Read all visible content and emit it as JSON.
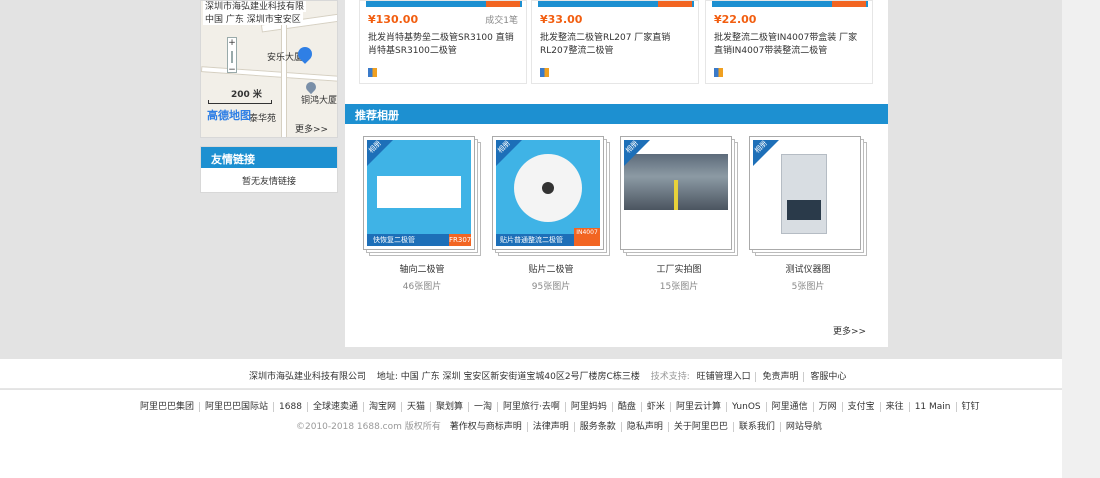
{
  "map": {
    "company_label": "深圳市海弘建业科技有限",
    "address_label": "中国 广东 深圳市宝安区",
    "place1": "安乐大厦",
    "place2": "铜鸿大厦",
    "place3": "泰华苑",
    "scale": "200 米",
    "provider": "高德地图",
    "more": "更多>>"
  },
  "friend_links": {
    "title": "友情链接",
    "empty": "暂无友情链接"
  },
  "products": [
    {
      "price": "¥130.00",
      "sold": "成交1笔",
      "name": "批发肖特基势垒二极管SR3100 直销肖特基SR3100二极管"
    },
    {
      "price": "¥33.00",
      "sold": "",
      "name": "批发整流二极管RL207 厂家直销RL207整流二极管"
    },
    {
      "price": "¥22.00",
      "sold": "",
      "name": "批发整流二极管IN4007带盒装 厂家直销IN4007带装整流二极管"
    }
  ],
  "recommend": {
    "title": "推荐相册",
    "ribbon": "相册",
    "albums": [
      {
        "name": "轴向二极管",
        "count": "46张图片",
        "caption": "快恢复二极管",
        "tag": "FR307"
      },
      {
        "name": "贴片二极管",
        "count": "95张图片",
        "caption": "贴片普通整流二极管",
        "tag": "IN4007"
      },
      {
        "name": "工厂实拍图",
        "count": "15张图片",
        "caption": "",
        "tag": ""
      },
      {
        "name": "测试仪器图",
        "count": "5张图片",
        "caption": "",
        "tag": ""
      }
    ],
    "more": "更多>>"
  },
  "footer": {
    "company": "深圳市海弘建业科技有限公司",
    "address": "地址: 中国 广东 深圳 宝安区新安街道宝城40区2号厂楼房C栋三楼",
    "support_label": "技术支持:",
    "support_links": [
      "旺铺管理入口",
      "免责声明",
      "客服中心"
    ],
    "links": [
      "阿里巴巴集团",
      "阿里巴巴国际站",
      "1688",
      "全球速卖通",
      "淘宝网",
      "天猫",
      "聚划算",
      "一淘",
      "阿里旅行·去啊",
      "阿里妈妈",
      "酷盘",
      "虾米",
      "阿里云计算",
      "YunOS",
      "阿里通信",
      "万网",
      "支付宝",
      "来往",
      "11 Main",
      "钉钉"
    ],
    "copyright": "©2010-2018 1688.com 版权所有",
    "legal_links": [
      "著作权与商标声明",
      "法律声明",
      "服务条款",
      "隐私声明",
      "关于阿里巴巴",
      "联系我们",
      "网站导航"
    ]
  }
}
